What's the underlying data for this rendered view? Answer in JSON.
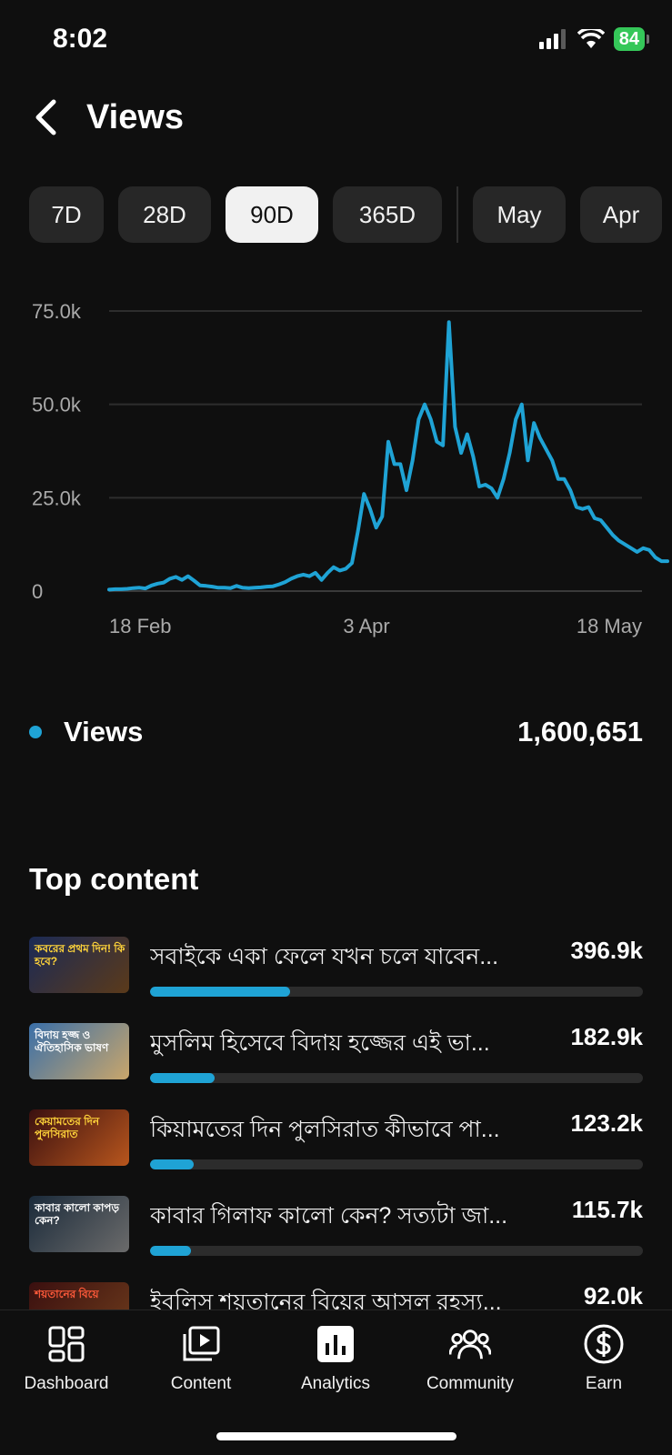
{
  "status": {
    "time": "8:02",
    "battery": "84"
  },
  "header": {
    "title": "Views"
  },
  "periods": [
    "7D",
    "28D",
    "90D",
    "365D",
    "May",
    "Apr"
  ],
  "active_period": "90D",
  "colors": {
    "accent": "#1fa3d5",
    "background": "#0f0f0f",
    "chip": "#272727",
    "chip_active": "#f1f1f1"
  },
  "chart_data": {
    "type": "line",
    "title": "",
    "xlabel": "",
    "ylabel": "",
    "x_tick_labels": [
      "18 Feb",
      "3 Apr",
      "18 May"
    ],
    "y_tick_labels": [
      "0",
      "25.0k",
      "50.0k",
      "75.0k"
    ],
    "y_ticks": [
      0,
      25000,
      50000,
      75000
    ],
    "ylim": [
      0,
      75000
    ],
    "grid": true,
    "series": [
      {
        "name": "Views",
        "color": "#1fa3d5",
        "values": [
          400,
          500,
          500,
          600,
          800,
          900,
          700,
          1500,
          2000,
          2300,
          3300,
          3800,
          3000,
          4000,
          2800,
          1500,
          1400,
          1200,
          900,
          900,
          800,
          1400,
          900,
          800,
          900,
          1000,
          1200,
          1300,
          1800,
          2400,
          3300,
          4000,
          4400,
          4000,
          4900,
          3000,
          4900,
          6400,
          5500,
          6000,
          7500,
          16000,
          26000,
          22000,
          17000,
          20000,
          40000,
          34000,
          34000,
          27000,
          35000,
          46000,
          50000,
          46000,
          40000,
          39000,
          72000,
          44000,
          37000,
          42000,
          36000,
          28000,
          28500,
          27500,
          25000,
          30000,
          37000,
          46000,
          50000,
          35000,
          45000,
          41000,
          38000,
          35000,
          30000,
          30000,
          27000,
          22500,
          22000,
          22500,
          19500,
          19000,
          17000,
          15000,
          13500,
          12500,
          11500,
          10500,
          11500,
          11000,
          9000,
          8000,
          8000
        ]
      }
    ]
  },
  "legend": {
    "label": "Views",
    "total": "1,600,651"
  },
  "top_content": {
    "title": "Top content",
    "items": [
      {
        "title": "সবাইকে একা ফেলে যখন চলে যাবেন...",
        "value": "396.9k",
        "views": 396900,
        "thumb_text": "কবরের প্রথম দিন! কি হবে?"
      },
      {
        "title": "মুসলিম হিসেবে বিদায় হজ্জের এই ভা...",
        "value": "182.9k",
        "views": 182900,
        "thumb_text": "বিদায় হজ্জ ও ঐতিহাসিক ভাষণ"
      },
      {
        "title": "কিয়ামতের দিন পুলসিরাত কীভাবে পা...",
        "value": "123.2k",
        "views": 123200,
        "thumb_text": "কেয়ামতের দিন পুলসিরাত"
      },
      {
        "title": "কাবার গিলাফ কালো কেন? সত্যটা জা...",
        "value": "115.7k",
        "views": 115700,
        "thumb_text": "কাবার কালো কাপড় কেন?"
      },
      {
        "title": "ইবলিস শয়তানের বিয়ের আসল রহস্য...",
        "value": "92.0k",
        "views": 92000,
        "thumb_text": "শয়তানের বিয়ে"
      }
    ]
  },
  "bottom_nav": [
    {
      "label": "Dashboard",
      "icon": "dashboard-icon"
    },
    {
      "label": "Content",
      "icon": "content-icon"
    },
    {
      "label": "Analytics",
      "icon": "analytics-icon"
    },
    {
      "label": "Community",
      "icon": "community-icon"
    },
    {
      "label": "Earn",
      "icon": "earn-icon"
    }
  ]
}
